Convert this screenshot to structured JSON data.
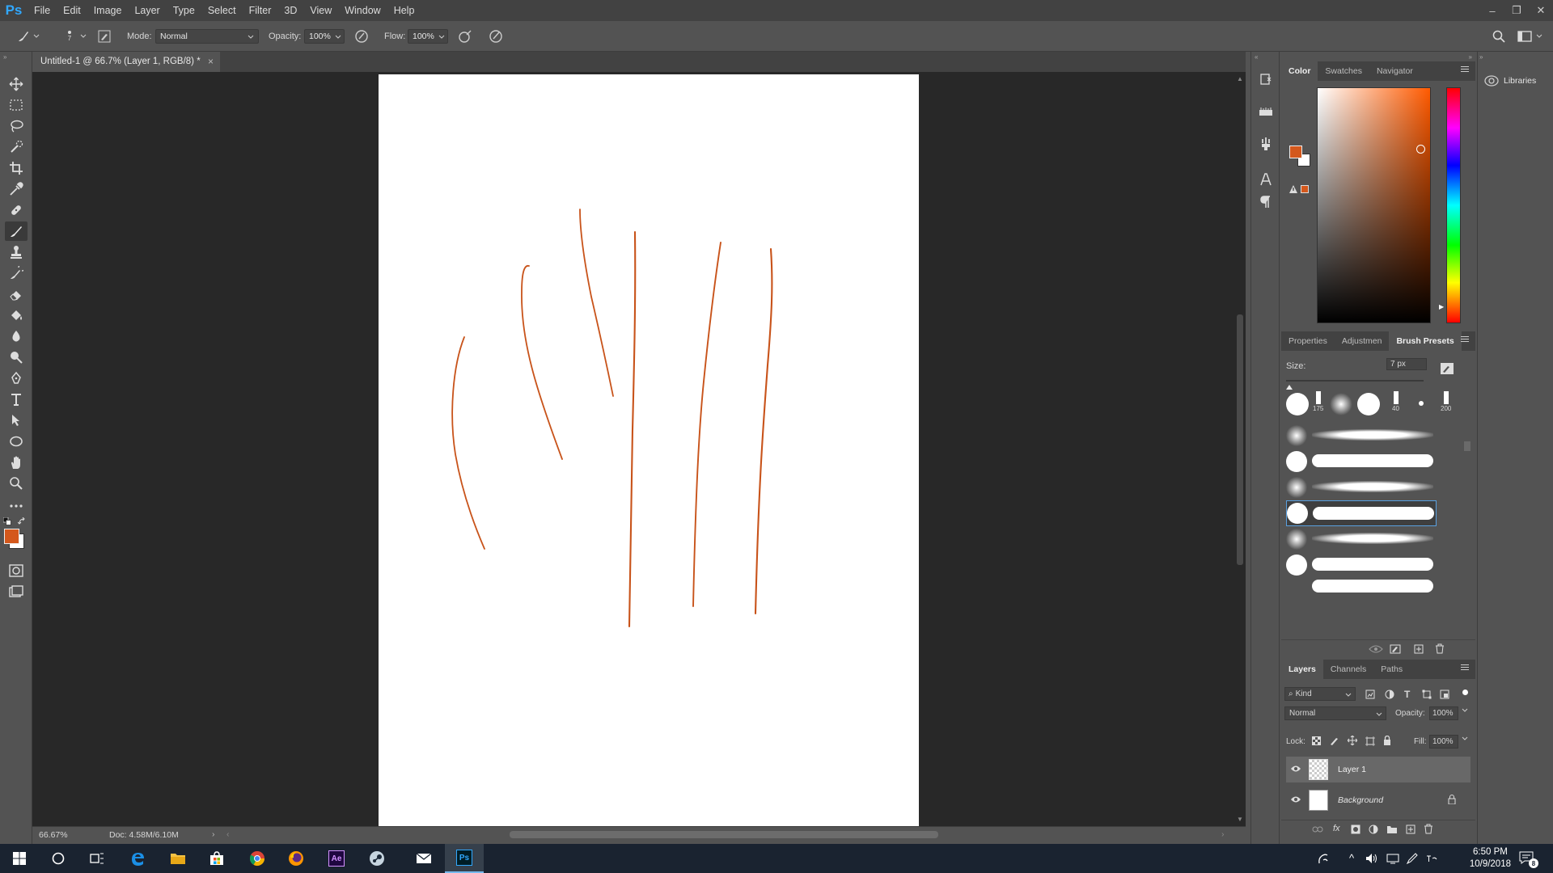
{
  "app": {
    "logo": "Ps",
    "menu": [
      "File",
      "Edit",
      "Image",
      "Layer",
      "Type",
      "Select",
      "Filter",
      "3D",
      "View",
      "Window",
      "Help"
    ],
    "window_controls": [
      "–",
      "❐",
      "✕"
    ]
  },
  "options_bar": {
    "brush_size": "7",
    "mode_label": "Mode:",
    "mode_value": "Normal",
    "opacity_label": "Opacity:",
    "opacity_value": "100%",
    "flow_label": "Flow:",
    "flow_value": "100%"
  },
  "document": {
    "tab_title": "Untitled-1 @ 66.7% (Layer 1, RGB/8) *",
    "close": "×",
    "zoom": "66.67%",
    "doc_info": "Doc: 4.58M/6.10M"
  },
  "tools": [
    "move-icon",
    "marquee-icon",
    "lasso-icon",
    "quick-select-icon",
    "crop-icon",
    "eyedropper-icon",
    "healing-icon",
    "brush-icon",
    "stamp-icon",
    "history-brush-icon",
    "eraser-icon",
    "paint-bucket-icon",
    "blur-icon",
    "dodge-icon",
    "pen-icon",
    "type-icon",
    "path-select-icon",
    "ellipse-icon",
    "hand-icon",
    "zoom-icon",
    "more-icon"
  ],
  "colors": {
    "foreground": "#d4581c",
    "background": "#ffffff",
    "stroke": "#c8531a",
    "accent": "#31a8ff"
  },
  "color_panel": {
    "tabs": [
      "Color",
      "Swatches",
      "Navigator"
    ]
  },
  "brush_panel": {
    "tabs": [
      "Properties",
      "Adjustmen",
      "Brush Presets"
    ],
    "size_label": "Size:",
    "size_value": "7 px",
    "preset_numbers": [
      "175",
      "40",
      "200"
    ]
  },
  "layers_panel": {
    "tabs": [
      "Layers",
      "Channels",
      "Paths"
    ],
    "filter_kind": "Kind",
    "blend_mode": "Normal",
    "opacity_label": "Opacity:",
    "opacity_value": "100%",
    "lock_label": "Lock:",
    "fill_label": "Fill:",
    "fill_value": "100%",
    "layers": [
      {
        "name": "Layer 1"
      },
      {
        "name": "Background"
      }
    ]
  },
  "libraries": {
    "label": "Libraries"
  },
  "taskbar": {
    "time": "6:50 PM",
    "date": "10/9/2018",
    "notification_count": "8",
    "ae_label": "Ae",
    "ps_label": "Ps"
  }
}
